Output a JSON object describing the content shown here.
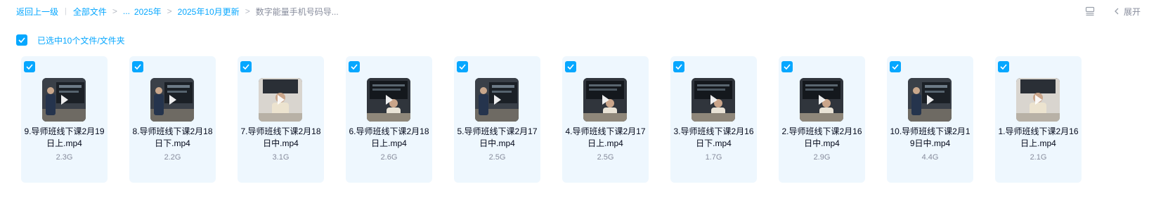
{
  "breadcrumb": {
    "back": "返回上一级",
    "all_files": "全部文件",
    "ellipsis": "...",
    "year": "2025年",
    "month": "2025年10月更新",
    "current": "数字能量手机号码导..."
  },
  "toolbar": {
    "expand": "展开"
  },
  "selection": {
    "label": "已选中10个文件/文件夹"
  },
  "files": [
    {
      "name": "9.导师班线下课2月19日上.mp4",
      "size": "2.3G",
      "scene": "presenter-left"
    },
    {
      "name": "8.导师班线下课2月18日下.mp4",
      "size": "2.2G",
      "scene": "presenter-left"
    },
    {
      "name": "7.导师班线下课2月18日中.mp4",
      "size": "3.1G",
      "scene": "presenter-center"
    },
    {
      "name": "6.导师班线下课2月18日上.mp4",
      "size": "2.6G",
      "scene": "presenter-seated"
    },
    {
      "name": "5.导师班线下课2月17日中.mp4",
      "size": "2.5G",
      "scene": "presenter-left"
    },
    {
      "name": "4.导师班线下课2月17日上.mp4",
      "size": "2.5G",
      "scene": "presenter-seated"
    },
    {
      "name": "3.导师班线下课2月16日下.mp4",
      "size": "1.7G",
      "scene": "presenter-seated"
    },
    {
      "name": "2.导师班线下课2月16日中.mp4",
      "size": "2.9G",
      "scene": "presenter-seated"
    },
    {
      "name": "10.导师班线下课2月19日中.mp4",
      "size": "4.4G",
      "scene": "presenter-left"
    },
    {
      "name": "1.导师班线下课2月16日上.mp4",
      "size": "2.1G",
      "scene": "presenter-center"
    }
  ],
  "colors": {
    "accent": "#06a7ff",
    "card_bg": "#eef7fe",
    "muted": "#878c9c"
  }
}
